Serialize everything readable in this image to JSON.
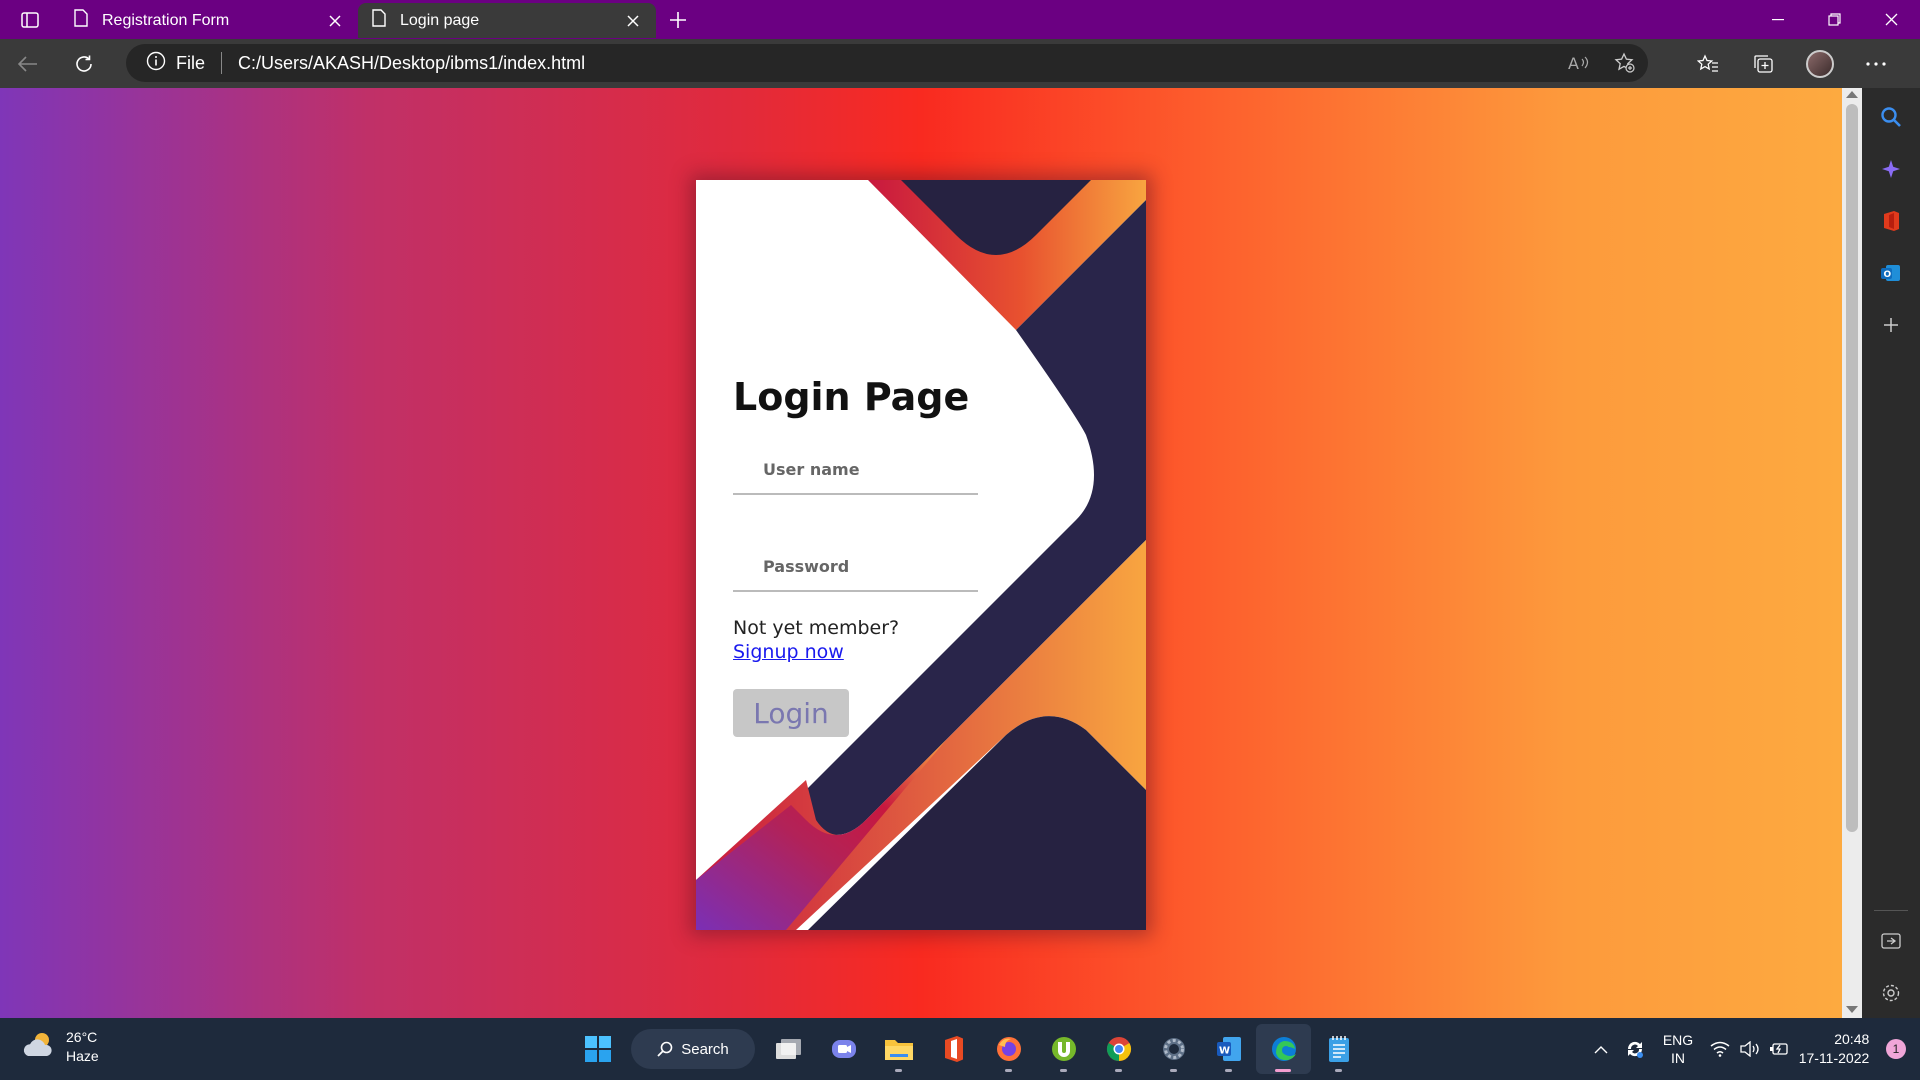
{
  "browser": {
    "tabs": [
      {
        "title": "Registration Form"
      },
      {
        "title": "Login page"
      }
    ],
    "address": {
      "scheme_label": "File",
      "url": "C:/Users/AKASH/Desktop/ibms1/index.html"
    }
  },
  "page": {
    "title": "Login Page",
    "username_placeholder": "User name",
    "password_placeholder": "Password",
    "signup_prompt": "Not yet member?",
    "signup_link": "Signup now",
    "login_button": "Login",
    "colors": {
      "gradient_left": "#7f36b8",
      "gradient_mid": "#f92a20",
      "gradient_right": "#fdaa40",
      "card_navy": "#262241",
      "card_orange": "#f8a540",
      "card_crimson": "#c8183f"
    }
  },
  "taskbar": {
    "weather": {
      "temp": "26°C",
      "condition": "Haze"
    },
    "search_label": "Search",
    "apps": [
      "start-icon",
      "task-view-icon",
      "teams-icon",
      "file-explorer-icon",
      "office-icon",
      "firefox-icon",
      "utorrent-icon",
      "chrome-icon",
      "settings-icon",
      "word-icon",
      "edge-icon",
      "notepad-icon"
    ],
    "language": {
      "line1": "ENG",
      "line2": "IN"
    },
    "time": "20:48",
    "date": "17-11-2022",
    "notification_count": "1"
  }
}
